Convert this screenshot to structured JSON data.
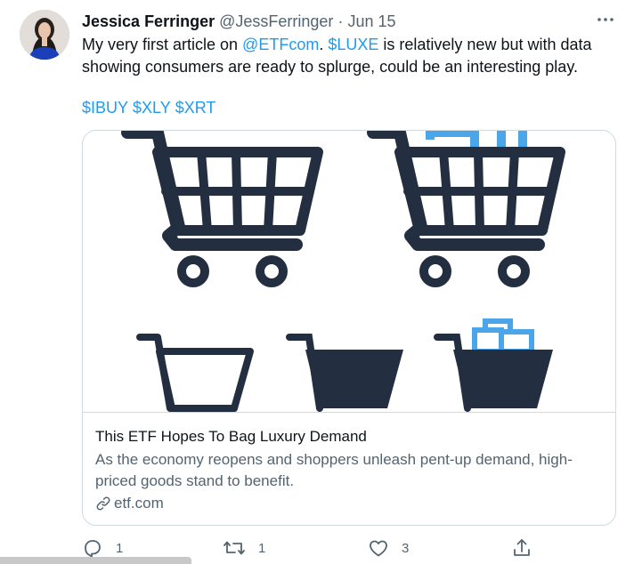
{
  "tweet": {
    "display_name": "Jessica Ferringer",
    "handle": "@JessFerringer",
    "separator": "·",
    "date": "Jun 15",
    "more_icon": "more-horizontal-icon",
    "text_part1": "My very first article on ",
    "mention": "@ETFcom",
    "text_part2": ". ",
    "cashtag_main": "$LUXE",
    "text_part3": " is relatively new but with data showing consumers are ready to splurge, could be an interesting play.",
    "cashtags": [
      "$IBUY",
      "$XLY",
      "$XRT"
    ],
    "link_color": "#1d9bf0"
  },
  "card": {
    "image_icon": "shopping-carts-illustration",
    "cart_color": "#232f40",
    "accent_color": "#4aa6e8",
    "title": "This ETF Hopes To Bag Luxury Demand",
    "description": "As the economy reopens and shoppers unleash pent-up demand, high-priced goods stand to benefit.",
    "domain_icon": "link-icon",
    "domain": "etf.com"
  },
  "actions": {
    "reply": {
      "icon": "reply-icon",
      "count": "1"
    },
    "retweet": {
      "icon": "retweet-icon",
      "count": "1"
    },
    "like": {
      "icon": "heart-icon",
      "count": "3"
    },
    "share": {
      "icon": "share-icon",
      "count": ""
    }
  }
}
